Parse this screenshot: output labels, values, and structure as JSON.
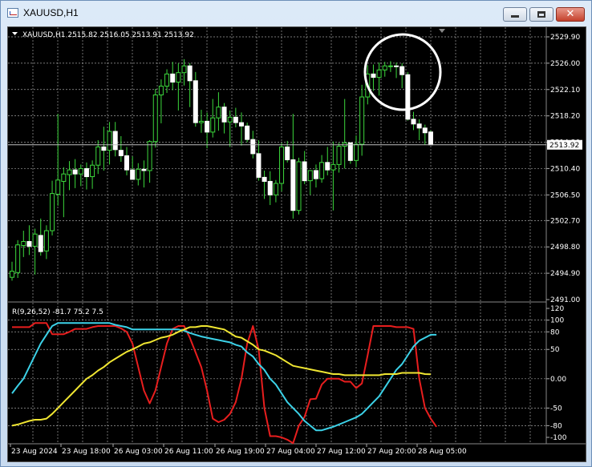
{
  "window": {
    "title": "XAUUSD,H1",
    "app_icon": "chart-window-icon",
    "controls": {
      "minimize": "minimize-icon",
      "maximize": "maximize-icon",
      "close": "✕"
    }
  },
  "price_panel": {
    "info": "XAUUSD,H1  2515.82 2516.05 2513.91 2513.92",
    "current_price": "2513.92",
    "y_labels": [
      "2529.90",
      "2526.00",
      "2522.10",
      "2518.20",
      "2514.30",
      "2510.40",
      "2506.50",
      "2502.70",
      "2498.80",
      "2494.90",
      "2491.00"
    ]
  },
  "indicator_panel": {
    "info": "R(9,26,52) -81.7 75.2 7.5",
    "y_labels": [
      "120",
      "100",
      "80",
      "50",
      "0.00",
      "-50",
      "-80",
      "-100"
    ]
  },
  "time_labels": [
    "23 Aug 2024",
    "23 Aug 18:00",
    "26 Aug 03:00",
    "26 Aug 11:00",
    "26 Aug 19:00",
    "27 Aug 04:00",
    "27 Aug 12:00",
    "27 Aug 20:00",
    "28 Aug 05:00"
  ],
  "colors": {
    "background": "#000000",
    "grid": "#c8c8c8",
    "candle": "#3cd83c",
    "current_price_line": "#c0c0c0",
    "annotation_circle": "#ffffff",
    "series_red": "#e81e1e",
    "series_cyan": "#3cd2e8",
    "series_yellow": "#f0e632"
  },
  "chart_data": [
    {
      "type": "candlestick",
      "symbol": "XAUUSD",
      "timeframe": "H1",
      "ylim": [
        2491.0,
        2529.9
      ],
      "x_tick_labels": [
        "23 Aug 2024",
        "23 Aug 18:00",
        "26 Aug 03:00",
        "26 Aug 11:00",
        "26 Aug 19:00",
        "27 Aug 04:00",
        "27 Aug 12:00",
        "27 Aug 20:00",
        "28 Aug 05:00"
      ],
      "candles": [
        {
          "o": 2494.3,
          "h": 2496.6,
          "l": 2493.8,
          "c": 2495.2
        },
        {
          "o": 2495.0,
          "h": 2499.8,
          "l": 2494.2,
          "c": 2499.1
        },
        {
          "o": 2499.0,
          "h": 2501.2,
          "l": 2497.3,
          "c": 2499.6
        },
        {
          "o": 2499.6,
          "h": 2502.0,
          "l": 2497.6,
          "c": 2498.9
        },
        {
          "o": 2498.9,
          "h": 2501.5,
          "l": 2494.7,
          "c": 2500.7
        },
        {
          "o": 2500.5,
          "h": 2503.0,
          "l": 2497.5,
          "c": 2498.1
        },
        {
          "o": 2498.2,
          "h": 2502.0,
          "l": 2497.0,
          "c": 2501.2
        },
        {
          "o": 2501.2,
          "h": 2508.6,
          "l": 2500.5,
          "c": 2506.7
        },
        {
          "o": 2506.6,
          "h": 2518.5,
          "l": 2504.9,
          "c": 2508.7
        },
        {
          "o": 2508.5,
          "h": 2510.6,
          "l": 2503.2,
          "c": 2509.6
        },
        {
          "o": 2509.5,
          "h": 2511.5,
          "l": 2507.2,
          "c": 2510.2
        },
        {
          "o": 2510.2,
          "h": 2511.8,
          "l": 2507.5,
          "c": 2509.6
        },
        {
          "o": 2509.6,
          "h": 2511.0,
          "l": 2507.8,
          "c": 2510.4
        },
        {
          "o": 2510.4,
          "h": 2511.3,
          "l": 2507.3,
          "c": 2509.2
        },
        {
          "o": 2509.2,
          "h": 2511.6,
          "l": 2507.4,
          "c": 2510.9
        },
        {
          "o": 2510.9,
          "h": 2514.6,
          "l": 2509.6,
          "c": 2513.6
        },
        {
          "o": 2513.6,
          "h": 2516.6,
          "l": 2510.1,
          "c": 2513.1
        },
        {
          "o": 2513.1,
          "h": 2517.3,
          "l": 2511.0,
          "c": 2515.9
        },
        {
          "o": 2515.9,
          "h": 2517.3,
          "l": 2512.2,
          "c": 2513.2
        },
        {
          "o": 2513.1,
          "h": 2515.2,
          "l": 2511.4,
          "c": 2512.3
        },
        {
          "o": 2512.3,
          "h": 2513.6,
          "l": 2509.4,
          "c": 2510.2
        },
        {
          "o": 2510.2,
          "h": 2512.2,
          "l": 2509.0,
          "c": 2508.8
        },
        {
          "o": 2508.8,
          "h": 2511.2,
          "l": 2507.9,
          "c": 2510.3
        },
        {
          "o": 2510.3,
          "h": 2511.6,
          "l": 2507.6,
          "c": 2510.1
        },
        {
          "o": 2510.1,
          "h": 2514.6,
          "l": 2508.3,
          "c": 2514.4
        },
        {
          "o": 2514.4,
          "h": 2522.2,
          "l": 2513.5,
          "c": 2521.3
        },
        {
          "o": 2521.3,
          "h": 2523.6,
          "l": 2517.1,
          "c": 2522.6
        },
        {
          "o": 2522.6,
          "h": 2525.1,
          "l": 2521.6,
          "c": 2524.4
        },
        {
          "o": 2524.4,
          "h": 2526.2,
          "l": 2522.0,
          "c": 2523.2
        },
        {
          "o": 2523.2,
          "h": 2526.0,
          "l": 2519.0,
          "c": 2524.6
        },
        {
          "o": 2524.6,
          "h": 2526.6,
          "l": 2522.7,
          "c": 2525.6
        },
        {
          "o": 2525.6,
          "h": 2526.0,
          "l": 2519.5,
          "c": 2523.4
        },
        {
          "o": 2523.4,
          "h": 2524.7,
          "l": 2516.6,
          "c": 2517.2
        },
        {
          "o": 2517.2,
          "h": 2519.1,
          "l": 2515.7,
          "c": 2517.4
        },
        {
          "o": 2517.4,
          "h": 2518.7,
          "l": 2513.4,
          "c": 2515.8
        },
        {
          "o": 2515.8,
          "h": 2520.7,
          "l": 2515.0,
          "c": 2517.9
        },
        {
          "o": 2517.9,
          "h": 2521.7,
          "l": 2516.0,
          "c": 2519.5
        },
        {
          "o": 2519.5,
          "h": 2520.1,
          "l": 2515.6,
          "c": 2517.3
        },
        {
          "o": 2517.3,
          "h": 2519.0,
          "l": 2513.6,
          "c": 2518.0
        },
        {
          "o": 2518.0,
          "h": 2519.4,
          "l": 2516.5,
          "c": 2517.2
        },
        {
          "o": 2517.2,
          "h": 2518.7,
          "l": 2513.8,
          "c": 2516.7
        },
        {
          "o": 2516.7,
          "h": 2517.2,
          "l": 2514.3,
          "c": 2514.7
        },
        {
          "o": 2514.7,
          "h": 2516.0,
          "l": 2511.9,
          "c": 2512.6
        },
        {
          "o": 2512.6,
          "h": 2514.6,
          "l": 2508.6,
          "c": 2509.1
        },
        {
          "o": 2509.1,
          "h": 2510.1,
          "l": 2505.9,
          "c": 2508.5
        },
        {
          "o": 2508.5,
          "h": 2510.0,
          "l": 2505.0,
          "c": 2506.5
        },
        {
          "o": 2506.5,
          "h": 2508.7,
          "l": 2505.4,
          "c": 2508.2
        },
        {
          "o": 2508.2,
          "h": 2514.2,
          "l": 2507.0,
          "c": 2513.6
        },
        {
          "o": 2513.6,
          "h": 2514.5,
          "l": 2511.3,
          "c": 2511.7
        },
        {
          "o": 2511.7,
          "h": 2518.5,
          "l": 2503.0,
          "c": 2504.2
        },
        {
          "o": 2504.2,
          "h": 2512.0,
          "l": 2503.6,
          "c": 2511.4
        },
        {
          "o": 2511.4,
          "h": 2513.0,
          "l": 2508.1,
          "c": 2508.6
        },
        {
          "o": 2508.6,
          "h": 2510.1,
          "l": 2506.5,
          "c": 2510.1
        },
        {
          "o": 2510.1,
          "h": 2511.0,
          "l": 2507.6,
          "c": 2508.9
        },
        {
          "o": 2508.9,
          "h": 2512.4,
          "l": 2508.3,
          "c": 2511.3
        },
        {
          "o": 2511.3,
          "h": 2513.6,
          "l": 2509.4,
          "c": 2510.2
        },
        {
          "o": 2510.2,
          "h": 2514.4,
          "l": 2504.2,
          "c": 2511.0
        },
        {
          "o": 2511.0,
          "h": 2514.2,
          "l": 2509.8,
          "c": 2513.7
        },
        {
          "o": 2513.7,
          "h": 2520.7,
          "l": 2510.4,
          "c": 2514.2
        },
        {
          "o": 2514.2,
          "h": 2514.3,
          "l": 2511.1,
          "c": 2511.6
        },
        {
          "o": 2511.6,
          "h": 2515.3,
          "l": 2510.6,
          "c": 2514.0
        },
        {
          "o": 2514.0,
          "h": 2522.8,
          "l": 2512.3,
          "c": 2521.0
        },
        {
          "o": 2521.0,
          "h": 2525.7,
          "l": 2519.9,
          "c": 2524.4
        },
        {
          "o": 2524.4,
          "h": 2525.8,
          "l": 2521.9,
          "c": 2523.9
        },
        {
          "o": 2523.9,
          "h": 2526.1,
          "l": 2521.2,
          "c": 2525.0
        },
        {
          "o": 2525.0,
          "h": 2526.2,
          "l": 2524.0,
          "c": 2525.6
        },
        {
          "o": 2525.6,
          "h": 2526.3,
          "l": 2524.7,
          "c": 2525.6
        },
        {
          "o": 2525.6,
          "h": 2526.1,
          "l": 2523.8,
          "c": 2525.5
        },
        {
          "o": 2525.5,
          "h": 2526.0,
          "l": 2522.3,
          "c": 2524.3
        },
        {
          "o": 2524.3,
          "h": 2524.7,
          "l": 2517.5,
          "c": 2517.7
        },
        {
          "o": 2517.7,
          "h": 2518.8,
          "l": 2516.1,
          "c": 2517.0
        },
        {
          "o": 2517.0,
          "h": 2517.7,
          "l": 2514.6,
          "c": 2516.4
        },
        {
          "o": 2516.4,
          "h": 2516.9,
          "l": 2513.9,
          "c": 2515.7
        },
        {
          "o": 2515.82,
          "h": 2516.05,
          "l": 2513.91,
          "c": 2513.92
        }
      ]
    },
    {
      "type": "line",
      "title": "R(9,26,52)",
      "ylim": [
        -100,
        120
      ],
      "latest_values": [
        -81.7,
        75.2,
        7.5
      ],
      "series": [
        {
          "color": "#e81e1e",
          "values": [
            88,
            88,
            88,
            88,
            95,
            95,
            95,
            76,
            76,
            76,
            80,
            85,
            85,
            85,
            88,
            90,
            90,
            90,
            90,
            86,
            80,
            60,
            20,
            -20,
            -42,
            -20,
            20,
            60,
            85,
            90,
            90,
            70,
            45,
            20,
            -20,
            -68,
            -74,
            -70,
            -60,
            -40,
            0,
            60,
            90,
            50,
            -50,
            -98,
            -98,
            -100,
            -104,
            -110,
            -80,
            -65,
            -35,
            -34,
            -10,
            0,
            0,
            0,
            -5,
            -5,
            -16,
            -8,
            40,
            90,
            90,
            90,
            90,
            88,
            88,
            88,
            85,
            0,
            -50,
            -68,
            -82
          ]
        },
        {
          "color": "#3cd2e8",
          "values": [
            -25,
            -12,
            0,
            20,
            40,
            60,
            75,
            90,
            95,
            95,
            95,
            95,
            95,
            95,
            95,
            95,
            95,
            95,
            92,
            90,
            88,
            84,
            84,
            84,
            84,
            84,
            84,
            84,
            84,
            84,
            82,
            78,
            75,
            72,
            70,
            68,
            66,
            64,
            62,
            58,
            55,
            45,
            38,
            25,
            15,
            0,
            -10,
            -25,
            -40,
            -50,
            -60,
            -72,
            -80,
            -88,
            -88,
            -85,
            -82,
            -78,
            -74,
            -70,
            -66,
            -60,
            -50,
            -40,
            -30,
            -15,
            0,
            15,
            25,
            40,
            55,
            65,
            70,
            75,
            75
          ]
        },
        {
          "color": "#f0e632",
          "values": [
            -80,
            -78,
            -75,
            -72,
            -70,
            -70,
            -68,
            -60,
            -50,
            -40,
            -30,
            -20,
            -10,
            0,
            6,
            14,
            20,
            28,
            34,
            40,
            46,
            50,
            55,
            60,
            62,
            66,
            70,
            72,
            75,
            80,
            84,
            88,
            88,
            90,
            90,
            88,
            86,
            84,
            78,
            72,
            70,
            64,
            58,
            50,
            48,
            44,
            40,
            34,
            28,
            22,
            20,
            18,
            16,
            14,
            12,
            10,
            8,
            8,
            6,
            6,
            6,
            6,
            6,
            6,
            6,
            8,
            8,
            8,
            10,
            10,
            10,
            10,
            8,
            7.5
          ]
        }
      ]
    }
  ]
}
